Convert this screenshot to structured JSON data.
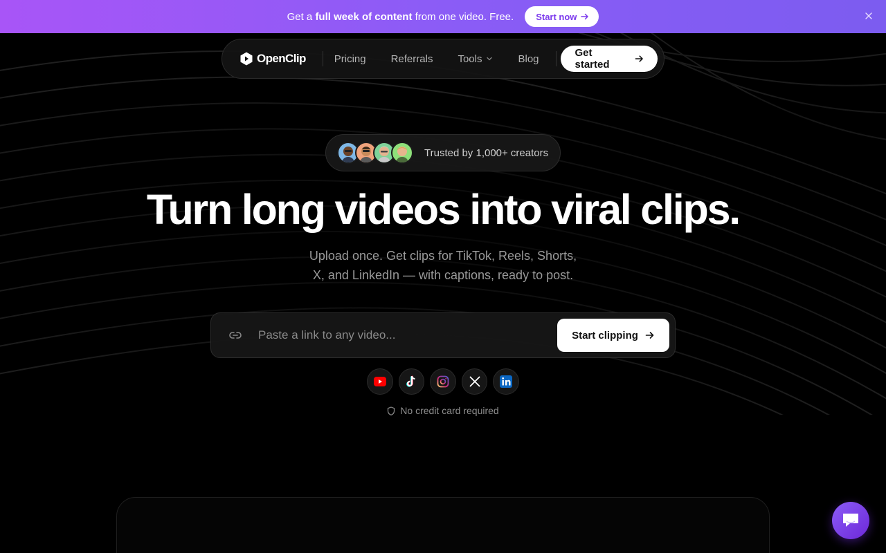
{
  "banner": {
    "text_before": "Get a ",
    "text_bold": "full week of content",
    "text_after": " from one video. Free.",
    "cta_label": "Start now",
    "accent": "#8b5cf6"
  },
  "nav": {
    "brand": "OpenClip",
    "links": [
      {
        "label": "Pricing"
      },
      {
        "label": "Referrals"
      },
      {
        "label": "Tools"
      },
      {
        "label": "Blog"
      }
    ],
    "cta_label": "Get started"
  },
  "hero": {
    "trust_text": "Trusted by 1,000+ creators",
    "title": "Turn long videos into viral clips.",
    "subtitle_line1": "Upload once. Get clips for TikTok, Reels, Shorts,",
    "subtitle_line2": "X, and LinkedIn — with captions, ready to post."
  },
  "clip_form": {
    "placeholder": "Paste a link to any video...",
    "value": "",
    "button_label": "Start clipping"
  },
  "platforms": [
    "youtube-icon",
    "tiktok-icon",
    "instagram-icon",
    "x-icon",
    "linkedin-icon"
  ],
  "no_card_text": "No credit card required"
}
